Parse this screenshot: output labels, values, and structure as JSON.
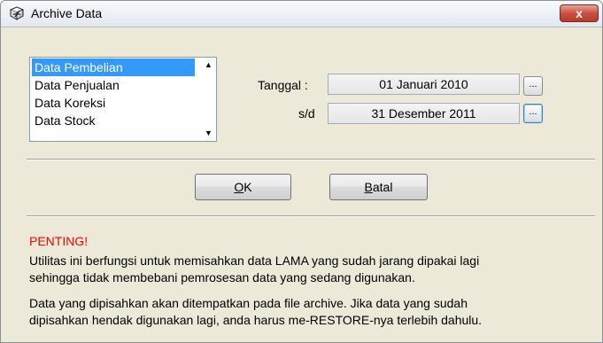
{
  "window": {
    "title": "Archive Data",
    "close_label": "x"
  },
  "list": {
    "items": [
      {
        "label": "Data Pembelian",
        "selected": true
      },
      {
        "label": "Data Penjualan",
        "selected": false
      },
      {
        "label": "Data Koreksi",
        "selected": false
      },
      {
        "label": "Data Stock",
        "selected": false
      }
    ]
  },
  "dates": {
    "from_label": "Tanggal :",
    "from_value": "01 Januari 2010",
    "to_label": "s/d",
    "to_value": "31 Desember 2011",
    "picker_label": "..."
  },
  "buttons": {
    "ok_accel": "O",
    "ok_rest": "K",
    "cancel_accel": "B",
    "cancel_rest": "atal"
  },
  "notice": {
    "heading": "PENTING!",
    "paragraph1_line1": "Utilitas ini berfungsi untuk memisahkan data LAMA yang sudah jarang dipakai lagi",
    "paragraph1_line2": "sehingga tidak membebani pemrosesan data yang sedang digunakan.",
    "paragraph2_line1": "Data yang dipisahkan akan ditempatkan pada file archive. Jika data yang sudah",
    "paragraph2_line2": "dipisahkan hendak digunakan lagi, anda harus me-RESTORE-nya terlebih dahulu."
  },
  "colors": {
    "selection": "#3399ff",
    "warning": "#ff0000",
    "dialog_bg": "#ece9d8"
  },
  "icons": {
    "app": "archive-app-icon",
    "close": "close-icon",
    "scroll_up": "scroll-up-arrow-icon",
    "scroll_down": "scroll-down-arrow-icon"
  }
}
